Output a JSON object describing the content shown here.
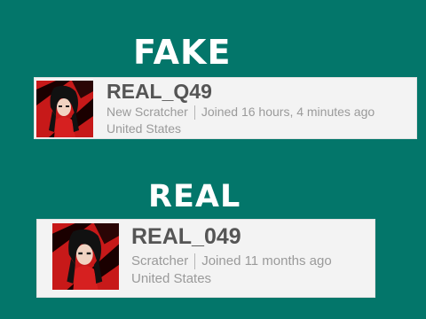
{
  "labels": {
    "fake": "FAKE",
    "real": "REAL"
  },
  "profiles": {
    "fake": {
      "username": "REAL_Q49",
      "status": "New Scratcher",
      "joined": "Joined 16 hours, 4 minutes ago",
      "location": "United States"
    },
    "real": {
      "username": "REAL_049",
      "status": "Scratcher",
      "joined": "Joined 11 months ago",
      "location": "United States"
    }
  },
  "colors": {
    "background": "#03766a",
    "card": "#f3f3f3",
    "username": "#555555",
    "meta": "#9a9a9a",
    "avatar_red": "#c71919"
  }
}
